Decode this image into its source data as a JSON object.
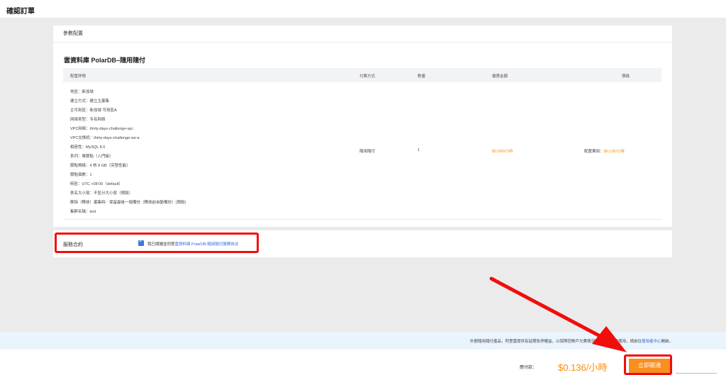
{
  "header": {
    "title": "確認訂單"
  },
  "params_section": {
    "title": "參數配置"
  },
  "product": {
    "title": "雲資料庫 PolarDB–隨用隨付"
  },
  "table": {
    "headers": [
      "配置詳情",
      "付費方式",
      "數量",
      "優惠金額",
      "價格"
    ],
    "config_lines": [
      "地區：新加坡",
      "建立方式：建立主叢集",
      "主可用區：新加坡 可用區A",
      "网络类型：专有网络",
      "VPC网络：thirty-days-challenge-vpc",
      "VPC交换机：thirty-days-challenge-sw-a",
      "相容性：MySQL 8.0",
      "系列：單節點（入門級）",
      "節點規格：4 核 8 GB（突發性能）",
      "節點個數：1",
      "時區：UTC +08:00（default）",
      "表名大小寫：不區分大小寫（預設）",
      "刪除（釋放）叢集時：保留最後一個備份（釋放前自動備份）(預設)",
      "集群名稱：test"
    ],
    "payment_method": "隨用隨付",
    "quantity": "1",
    "discount": "$0.000/小時",
    "price_label": "配置費用：",
    "price_value": "$0.136/小時"
  },
  "agreement": {
    "label": "服務合約",
    "checked": true,
    "text": "我已閱讀並同意",
    "link": "雲資料庫 PolarDB-隨用隨付服務协议"
  },
  "notice": {
    "text": "計劃隨用隨付產品，阿里雲提供有延期免停權益，以保障您賬戶欠費情況下服務的正常使用",
    "mid": "，請前往",
    "link": "使用者中心",
    "suffix": "開啟。"
  },
  "footer": {
    "payable_label": "應付款：",
    "payable_amount": "$0.136/小時",
    "open_button": "立即開通"
  },
  "colors": {
    "accent_orange": "#ff8a00",
    "link_blue": "#2d6ad6",
    "annotation_red": "#f20c0c"
  }
}
